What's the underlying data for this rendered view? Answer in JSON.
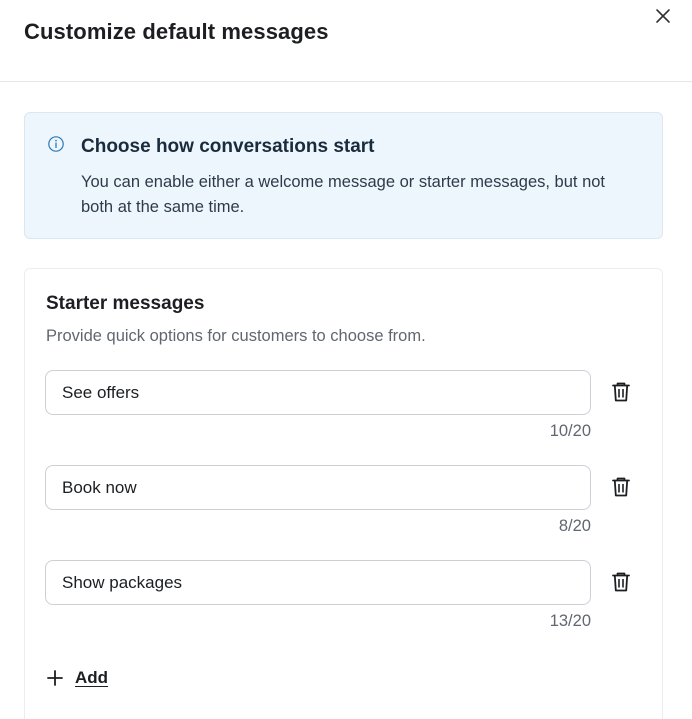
{
  "dialog": {
    "title": "Customize default messages",
    "close_icon": "close-icon"
  },
  "info": {
    "icon": "info-icon",
    "title": "Choose how conversations start",
    "text": "You can enable either a welcome message or starter messages, but not both at the same time."
  },
  "starter": {
    "title": "Starter messages",
    "subtitle": "Provide quick options for customers to choose from.",
    "messages": [
      {
        "value": "See offers",
        "counter": "10/20"
      },
      {
        "value": "Book now",
        "counter": "8/20"
      },
      {
        "value": "Show packages",
        "counter": "13/20"
      }
    ],
    "delete_icon": "trash-icon",
    "add_label": "Add",
    "add_icon": "plus-icon"
  },
  "colors": {
    "info_bg": "#eef6fd",
    "info_icon": "#2d7ab7",
    "border": "#ccd0d5",
    "muted_text": "#606770"
  }
}
